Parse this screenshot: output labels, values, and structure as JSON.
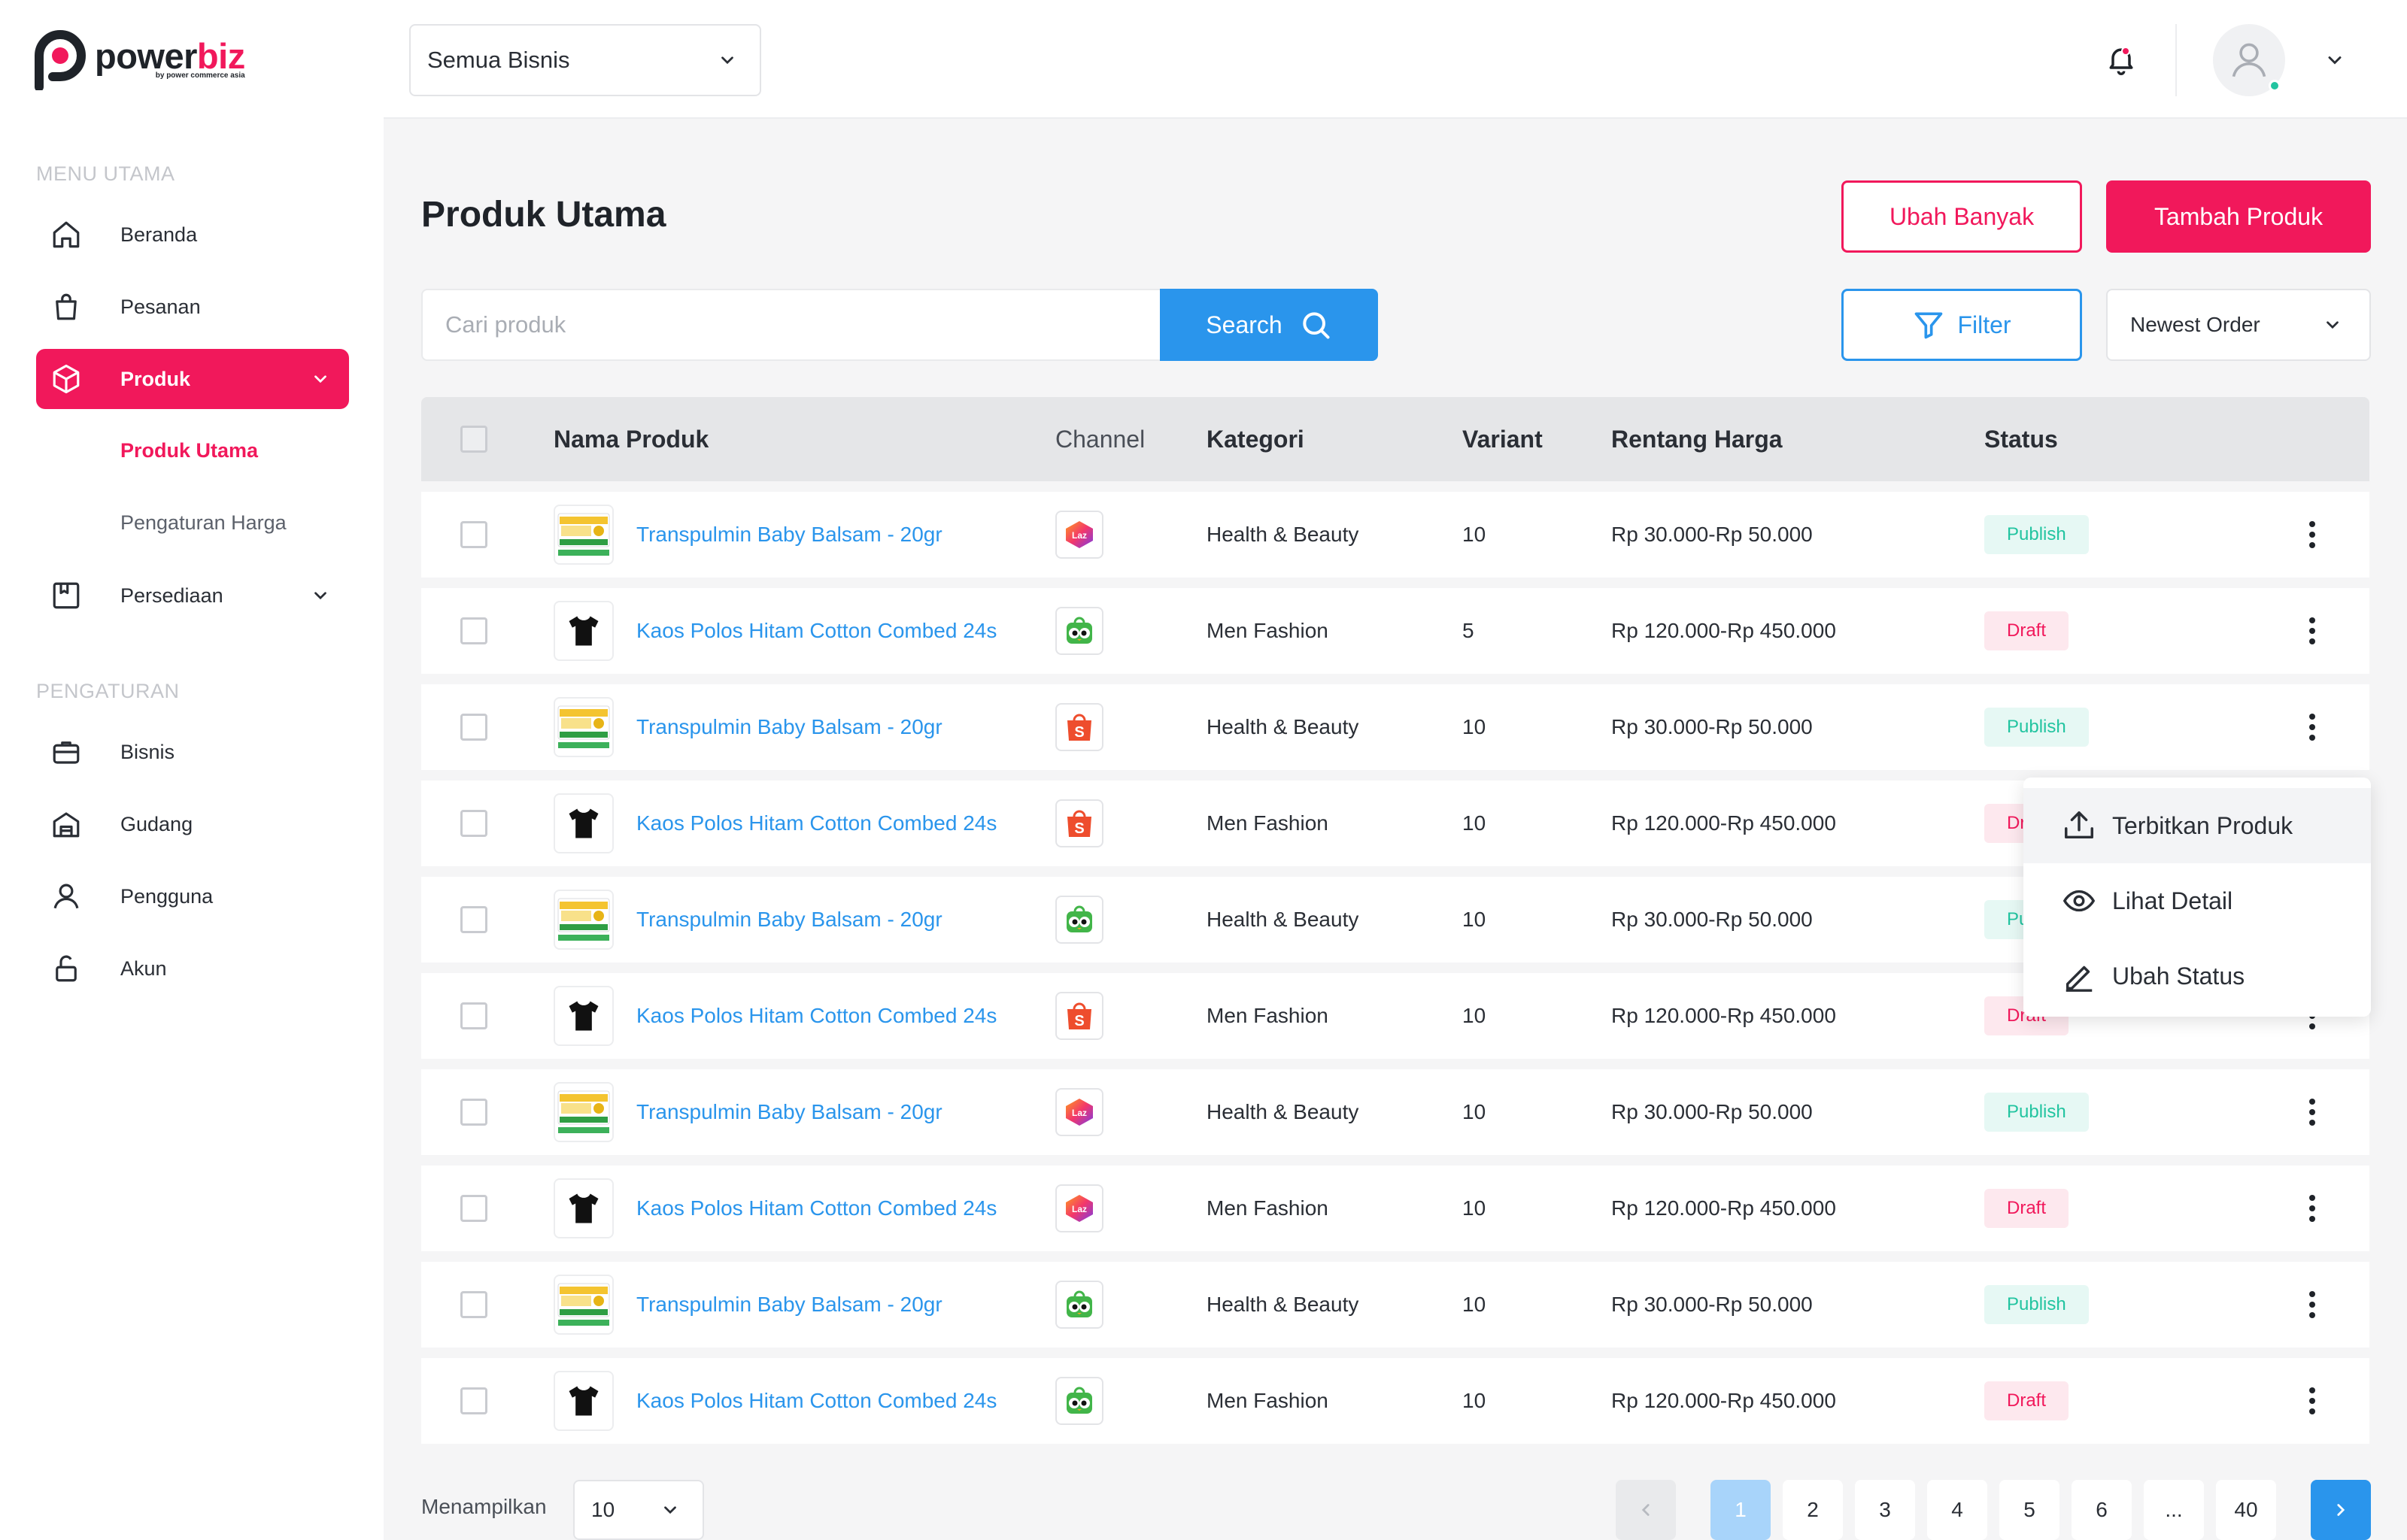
{
  "brand": {
    "name_part1": "power",
    "name_part2": "biz",
    "tagline": "by power commerce asia"
  },
  "sidebar": {
    "section_main": "MENU UTAMA",
    "section_settings": "PENGATURAN",
    "items": [
      {
        "label": "Beranda",
        "icon": "home-icon"
      },
      {
        "label": "Pesanan",
        "icon": "shopping-bag-icon"
      },
      {
        "label": "Produk",
        "icon": "box-icon",
        "active": true,
        "expanded": true
      },
      {
        "label": "Persediaan",
        "icon": "inventory-icon"
      },
      {
        "label": "Bisnis",
        "icon": "briefcase-icon"
      },
      {
        "label": "Gudang",
        "icon": "warehouse-icon"
      },
      {
        "label": "Pengguna",
        "icon": "user-icon"
      },
      {
        "label": "Akun",
        "icon": "unlock-icon"
      }
    ],
    "sub_items": [
      {
        "label": "Produk Utama",
        "active": true
      },
      {
        "label": "Pengaturan Harga",
        "active": false
      }
    ]
  },
  "header": {
    "business_select": "Semua Bisnis"
  },
  "page": {
    "title": "Produk Utama",
    "bulk_edit_label": "Ubah Banyak",
    "add_product_label": "Tambah Produk",
    "search_placeholder": "Cari produk",
    "search_label": "Search",
    "filter_label": "Filter",
    "sort_value": "Newest Order"
  },
  "table": {
    "columns": [
      "Nama Produk",
      "Channel",
      "Kategori",
      "Variant",
      "Rentang Harga",
      "Status"
    ],
    "rows": [
      {
        "name": "Transpulmin Baby Balsam - 20gr",
        "thumb": "balsam",
        "channel": "lazada",
        "category": "Health & Beauty",
        "variant": "10",
        "price": "Rp 30.000-Rp 50.000",
        "status": "Publish"
      },
      {
        "name": "Kaos Polos Hitam Cotton Combed 24s",
        "thumb": "tshirt",
        "channel": "tokopedia",
        "category": "Men Fashion",
        "variant": "5",
        "price": "Rp 120.000-Rp 450.000",
        "status": "Draft"
      },
      {
        "name": "Transpulmin Baby Balsam - 20gr",
        "thumb": "balsam",
        "channel": "shopee",
        "category": "Health & Beauty",
        "variant": "10",
        "price": "Rp 30.000-Rp 50.000",
        "status": "Publish"
      },
      {
        "name": "Kaos Polos Hitam Cotton Combed 24s",
        "thumb": "tshirt",
        "channel": "shopee",
        "category": "Men Fashion",
        "variant": "10",
        "price": "Rp 120.000-Rp 450.000",
        "status": "Draft"
      },
      {
        "name": "Transpulmin Baby Balsam - 20gr",
        "thumb": "balsam",
        "channel": "tokopedia",
        "category": "Health & Beauty",
        "variant": "10",
        "price": "Rp 30.000-Rp 50.000",
        "status": "Publish"
      },
      {
        "name": "Kaos Polos Hitam Cotton Combed 24s",
        "thumb": "tshirt",
        "channel": "shopee",
        "category": "Men Fashion",
        "variant": "10",
        "price": "Rp 120.000-Rp 450.000",
        "status": "Draft"
      },
      {
        "name": "Transpulmin Baby Balsam - 20gr",
        "thumb": "balsam",
        "channel": "lazada",
        "category": "Health & Beauty",
        "variant": "10",
        "price": "Rp 30.000-Rp 50.000",
        "status": "Publish"
      },
      {
        "name": "Kaos Polos Hitam Cotton Combed 24s",
        "thumb": "tshirt",
        "channel": "lazada",
        "category": "Men Fashion",
        "variant": "10",
        "price": "Rp 120.000-Rp 450.000",
        "status": "Draft"
      },
      {
        "name": "Transpulmin Baby Balsam - 20gr",
        "thumb": "balsam",
        "channel": "tokopedia",
        "category": "Health & Beauty",
        "variant": "10",
        "price": "Rp 30.000-Rp 50.000",
        "status": "Publish"
      },
      {
        "name": "Kaos Polos Hitam Cotton Combed 24s",
        "thumb": "tshirt",
        "channel": "tokopedia",
        "category": "Men Fashion",
        "variant": "10",
        "price": "Rp 120.000-Rp 450.000",
        "status": "Draft"
      }
    ]
  },
  "action_menu": {
    "items": [
      {
        "label": "Terbitkan Produk",
        "icon": "upload-icon"
      },
      {
        "label": "Lihat Detail",
        "icon": "eye-icon"
      },
      {
        "label": "Ubah Status",
        "icon": "edit-icon"
      }
    ]
  },
  "footer": {
    "show_label": "Menampilkan",
    "per_page": "10",
    "pages": [
      "1",
      "2",
      "3",
      "4",
      "5",
      "6",
      "...",
      "40"
    ],
    "current_page": "1"
  },
  "colors": {
    "accent": "#F1185B",
    "blue": "#2A95EC",
    "publish": "#22C4A0",
    "draft": "#F1185B",
    "lazada": "#F36C3A",
    "shopee": "#EE4D2D",
    "tokopedia": "#42B549"
  }
}
